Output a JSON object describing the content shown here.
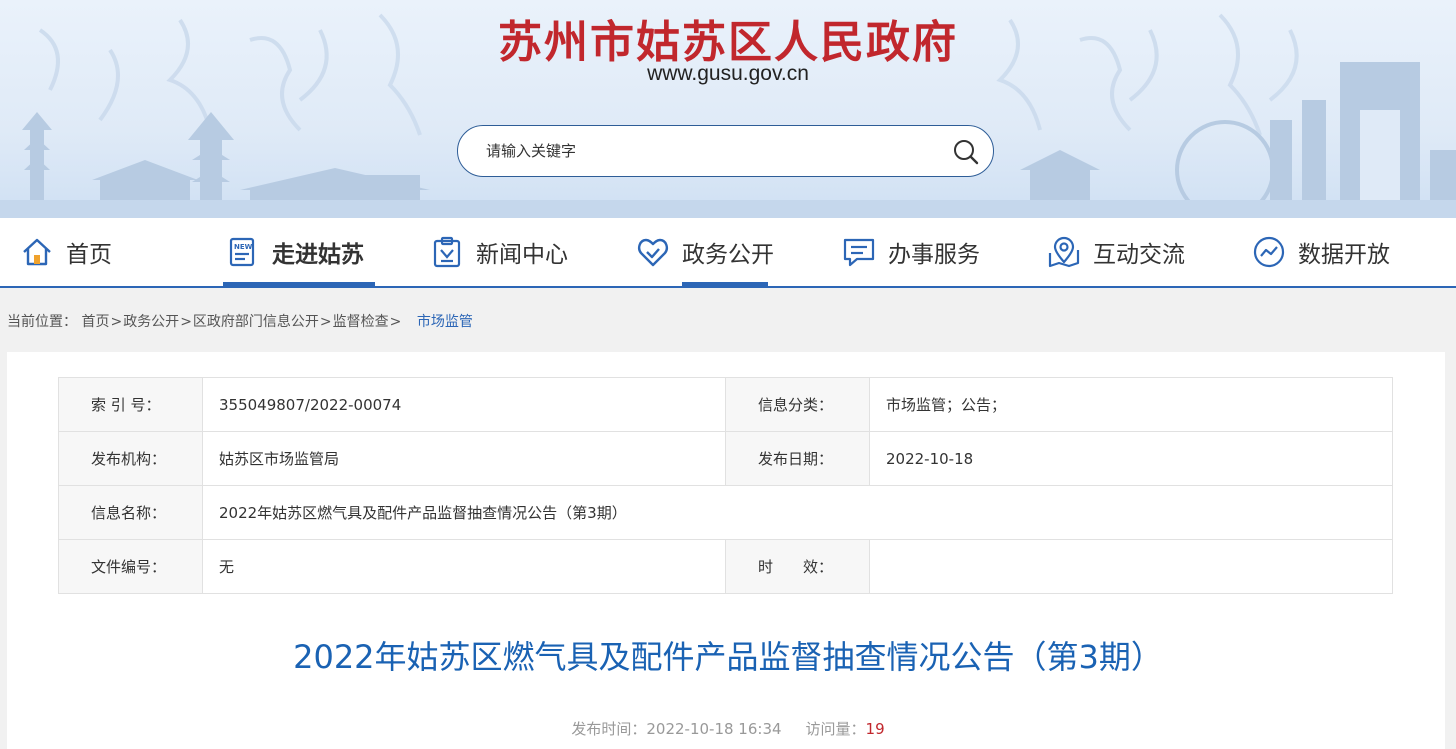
{
  "header": {
    "site_title": "苏州市姑苏区人民政府",
    "site_url": "www.gusu.gov.cn",
    "search": {
      "placeholder": "请输入关键字",
      "icon": "search-icon"
    }
  },
  "nav": {
    "items": [
      {
        "label": "首页",
        "icon": "home-icon",
        "active": false
      },
      {
        "label": "走进姑苏",
        "icon": "news-document-icon",
        "active": true
      },
      {
        "label": "新闻中心",
        "icon": "clipboard-icon",
        "active": false
      },
      {
        "label": "政务公开",
        "icon": "heart-hands-icon",
        "active": false
      },
      {
        "label": "办事服务",
        "icon": "chat-icon",
        "active": false
      },
      {
        "label": "互动交流",
        "icon": "map-pin-icon",
        "active": false
      },
      {
        "label": "数据开放",
        "icon": "chart-circle-icon",
        "active": false
      }
    ],
    "accent_color": "#2c66b6"
  },
  "breadcrumb": {
    "prefix": "当前位置：",
    "items": [
      "首页",
      "政务公开",
      "区政府部门信息公开",
      "监督检查"
    ],
    "current": "市场监管"
  },
  "meta": {
    "index_label": "索 引 号：",
    "index_value": "355049807/2022-00074",
    "category_label": "信息分类：",
    "category_value": "市场监管；公告；",
    "publisher_label": "发布机构：",
    "publisher_value": "姑苏区市场监管局",
    "date_label": "发布日期：",
    "date_value": "2022-10-18",
    "name_label": "信息名称：",
    "name_value": "2022年姑苏区燃气具及配件产品监督抽查情况公告（第3期）",
    "docno_label": "文件编号：",
    "docno_value": "无",
    "validity_label": "时　　效：",
    "validity_value": ""
  },
  "article": {
    "title": "2022年姑苏区燃气具及配件产品监督抽查情况公告（第3期）",
    "published_label": "发布时间：",
    "published_value": "2022-10-18 16:34",
    "views_label": "访问量：",
    "views_value": "19"
  },
  "colors": {
    "title_red": "#c1272d",
    "link_blue": "#1a62b3"
  }
}
